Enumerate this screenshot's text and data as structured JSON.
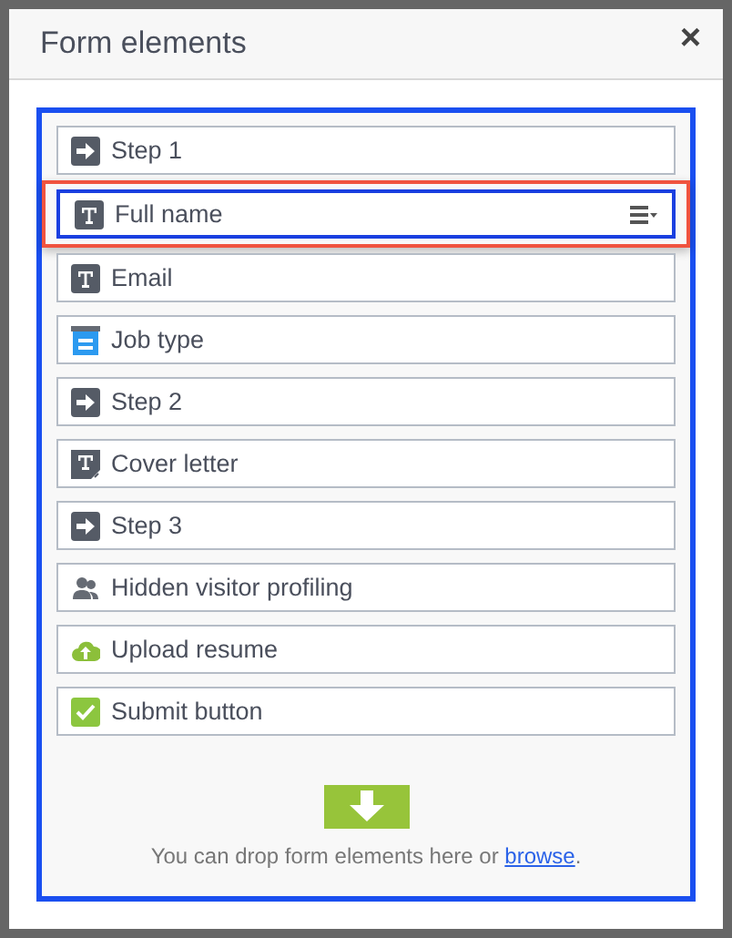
{
  "dialog": {
    "title": "Form elements",
    "close": "×"
  },
  "elements": [
    {
      "kind": "step",
      "label": "Step 1",
      "selected": false
    },
    {
      "kind": "text",
      "label": "Full name",
      "selected": true
    },
    {
      "kind": "text",
      "label": "Email",
      "selected": false
    },
    {
      "kind": "dropdown",
      "label": "Job type",
      "selected": false
    },
    {
      "kind": "step",
      "label": "Step 2",
      "selected": false
    },
    {
      "kind": "textarea",
      "label": "Cover letter",
      "selected": false
    },
    {
      "kind": "step",
      "label": "Step 3",
      "selected": false
    },
    {
      "kind": "profiling",
      "label": "Hidden visitor profiling",
      "selected": false
    },
    {
      "kind": "upload",
      "label": "Upload resume",
      "selected": false
    },
    {
      "kind": "submit",
      "label": "Submit button",
      "selected": false
    }
  ],
  "drop_hint": {
    "before": "You can drop form elements here or ",
    "link": "browse",
    "after": "."
  }
}
